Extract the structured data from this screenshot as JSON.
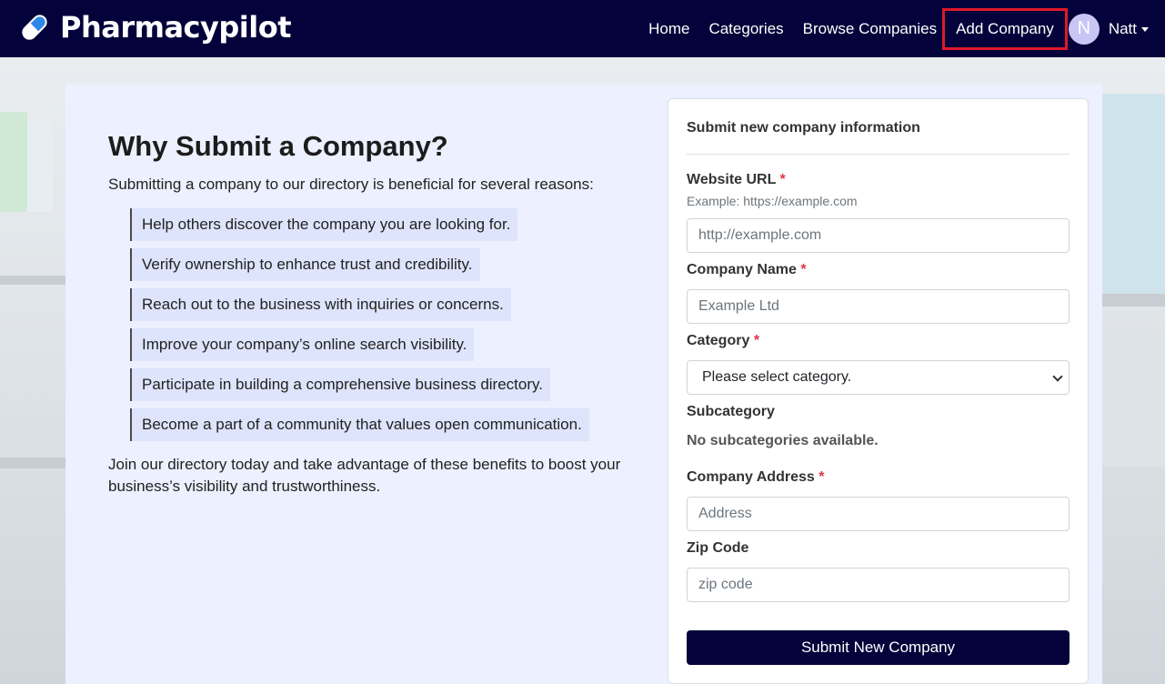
{
  "brand": {
    "name": "Pharmacypilot",
    "icon": "pill-icon"
  },
  "nav": {
    "items": [
      {
        "label": "Home"
      },
      {
        "label": "Categories"
      },
      {
        "label": "Browse Companies"
      },
      {
        "label": "Add Company"
      }
    ],
    "active": "Add Company",
    "user": {
      "avatar_initial": "N",
      "name": "Natt"
    }
  },
  "info": {
    "title": "Why Submit a Company?",
    "intro": "Submitting a company to our directory is beneficial for several reasons:",
    "reasons": [
      "Help others discover the company you are looking for.",
      "Verify ownership to enhance trust and credibility.",
      "Reach out to the business with inquiries or concerns.",
      "Improve your company’s online search visibility.",
      "Participate in building a comprehensive business directory.",
      "Become a part of a community that values open communication."
    ],
    "outro": "Join our directory today and take advantage of these benefits to boost your business’s visibility and trustworthiness."
  },
  "form": {
    "title": "Submit new company information",
    "required_mark": "*",
    "website": {
      "label": "Website URL",
      "hint": "Example: https://example.com",
      "placeholder": "http://example.com",
      "value": ""
    },
    "company_name": {
      "label": "Company Name",
      "placeholder": "Example Ltd",
      "value": ""
    },
    "category": {
      "label": "Category",
      "selected": "Please select category."
    },
    "subcategory": {
      "label": "Subcategory",
      "empty_text": "No subcategories available."
    },
    "address": {
      "label": "Company Address",
      "placeholder": "Address",
      "value": ""
    },
    "zip": {
      "label": "Zip Code",
      "placeholder": "zip code",
      "value": ""
    },
    "submit_label": "Submit New Company"
  },
  "colors": {
    "navbar": "#03023a",
    "panel": "#ecf0ff",
    "reason_bg": "#dde4fb",
    "required": "#dc3545",
    "highlight_box": "#e0182a",
    "avatar": "#c9c5f5"
  }
}
